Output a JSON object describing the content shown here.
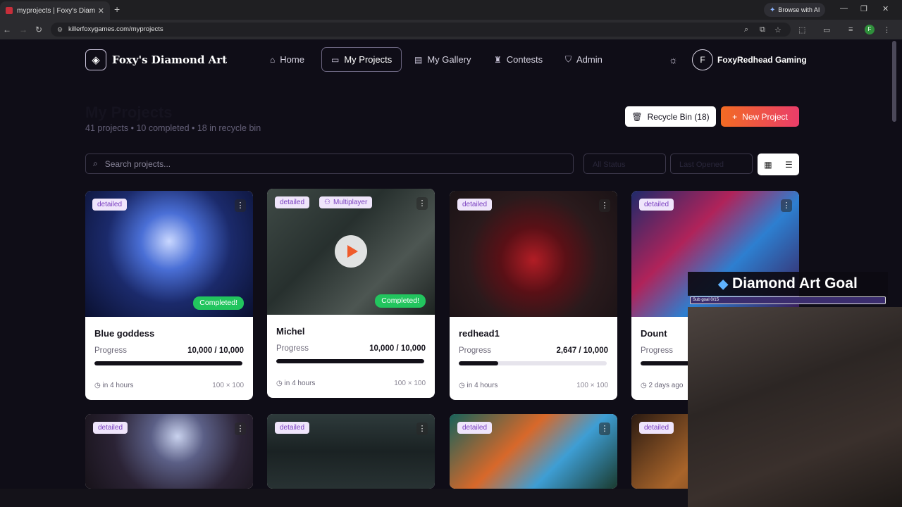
{
  "browser": {
    "tab_title": "myprojects | Foxy's Diamond Art",
    "url": "killerfoxygames.com/myprojects",
    "browse_ai_label": "Browse with AI",
    "profile_initial": "F"
  },
  "header": {
    "logo_text": "Foxy's Diamond Art",
    "nav": [
      {
        "label": "Home",
        "icon": "home-icon"
      },
      {
        "label": "My Projects",
        "icon": "folder-icon"
      },
      {
        "label": "My Gallery",
        "icon": "gallery-icon"
      },
      {
        "label": "Contests",
        "icon": "trophy-icon"
      },
      {
        "label": "Admin",
        "icon": "shield-icon"
      }
    ],
    "avatar_initial": "F",
    "username": "FoxyRedhead Gaming"
  },
  "page": {
    "title": "My Projects",
    "stats": "41 projects • 10 completed • 18 in recycle bin",
    "recycle_label": "Recycle Bin (18)",
    "new_label": "New Project"
  },
  "filters": {
    "search_placeholder": "Search projects...",
    "status_select": "All Status",
    "sort_select": "Last Opened"
  },
  "projects": [
    {
      "name": "Blue goddess",
      "tag": "detailed",
      "progress_label": "Progress",
      "progress_text": "10,000 / 10,000",
      "progress": 1.0,
      "completed": "Completed!",
      "time": "in 4 hours",
      "size": "100 × 100"
    },
    {
      "name": "Michel",
      "tag": "detailed",
      "tag2": "Multiplayer",
      "progress_label": "Progress",
      "progress_text": "10,000 / 10,000",
      "progress": 1.0,
      "completed": "Completed!",
      "time": "in 4 hours",
      "size": "100 × 100"
    },
    {
      "name": "redhead1",
      "tag": "detailed",
      "progress_label": "Progress",
      "progress_text": "2,647 / 10,000",
      "progress": 0.2647,
      "time": "in 4 hours",
      "size": "100 × 100"
    },
    {
      "name": "Dount",
      "tag": "detailed",
      "progress_label": "Progress",
      "time": "2 days ago"
    },
    {
      "tag": "detailed"
    },
    {
      "tag": "detailed"
    },
    {
      "tag": "detailed"
    },
    {
      "tag": "detailed"
    }
  ],
  "overlay": {
    "title": "Diamond Art Goal",
    "subgoal": "Sub goal 0/15"
  },
  "colors": {
    "accent_start": "#f26b23",
    "accent_end": "#ea3d6a",
    "completed_badge": "#22c55e",
    "tag_bg": "#efe5fb",
    "tag_text": "#7a3fc0"
  }
}
